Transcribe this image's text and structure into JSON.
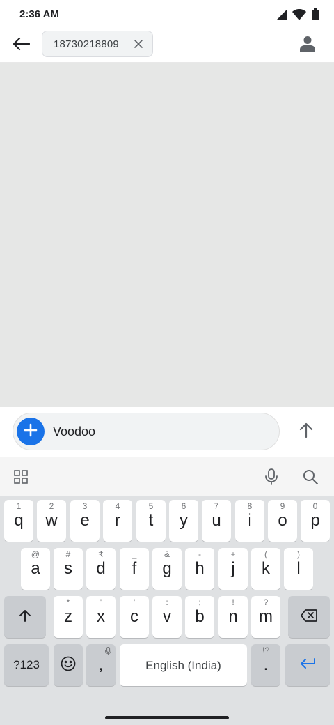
{
  "status_bar": {
    "time": "2:36 AM",
    "icons": [
      "signal-icon",
      "wifi-icon",
      "battery-icon"
    ]
  },
  "app_bar": {
    "back_icon": "arrow-left-icon",
    "recipient": "18730218809",
    "chip_remove_icon": "close-icon",
    "contact_icon": "person-icon"
  },
  "compose": {
    "attach_icon": "plus-icon",
    "text": "Voodoo",
    "send_icon": "arrow-up-icon"
  },
  "keyboard": {
    "toolbar_icons": [
      "grid-icon",
      "microphone-icon",
      "search-icon"
    ],
    "row1": [
      {
        "key": "q",
        "hint": "1"
      },
      {
        "key": "w",
        "hint": "2"
      },
      {
        "key": "e",
        "hint": "3"
      },
      {
        "key": "r",
        "hint": "4"
      },
      {
        "key": "t",
        "hint": "5"
      },
      {
        "key": "y",
        "hint": "6"
      },
      {
        "key": "u",
        "hint": "7"
      },
      {
        "key": "i",
        "hint": "8"
      },
      {
        "key": "o",
        "hint": "9"
      },
      {
        "key": "p",
        "hint": "0"
      }
    ],
    "row2": [
      {
        "key": "a",
        "hint": "@"
      },
      {
        "key": "s",
        "hint": "#"
      },
      {
        "key": "d",
        "hint": "₹"
      },
      {
        "key": "f",
        "hint": "_"
      },
      {
        "key": "g",
        "hint": "&"
      },
      {
        "key": "h",
        "hint": "-"
      },
      {
        "key": "j",
        "hint": "+"
      },
      {
        "key": "k",
        "hint": "("
      },
      {
        "key": "l",
        "hint": ")"
      }
    ],
    "row3": [
      {
        "key": "z",
        "hint": "*"
      },
      {
        "key": "x",
        "hint": "\""
      },
      {
        "key": "c",
        "hint": "'"
      },
      {
        "key": "v",
        "hint": ":"
      },
      {
        "key": "b",
        "hint": ";"
      },
      {
        "key": "n",
        "hint": "!"
      },
      {
        "key": "m",
        "hint": "?"
      }
    ],
    "shift_icon": "shift-arrow-up-icon",
    "backspace_icon": "backspace-icon",
    "symbols_label": "?123",
    "emoji_icon": "emoji-icon",
    "comma": {
      "key": ",",
      "hint_icon": "microphone-icon"
    },
    "space_label": "English (India)",
    "period": {
      "key": ".",
      "hint": "!?"
    },
    "enter_icon": "enter-icon"
  },
  "colors": {
    "accent": "#1a73e8",
    "conversation_bg": "#e6e7e6",
    "keyboard_bg": "#dfe1e3",
    "enter_icon": "#1a73e8"
  }
}
